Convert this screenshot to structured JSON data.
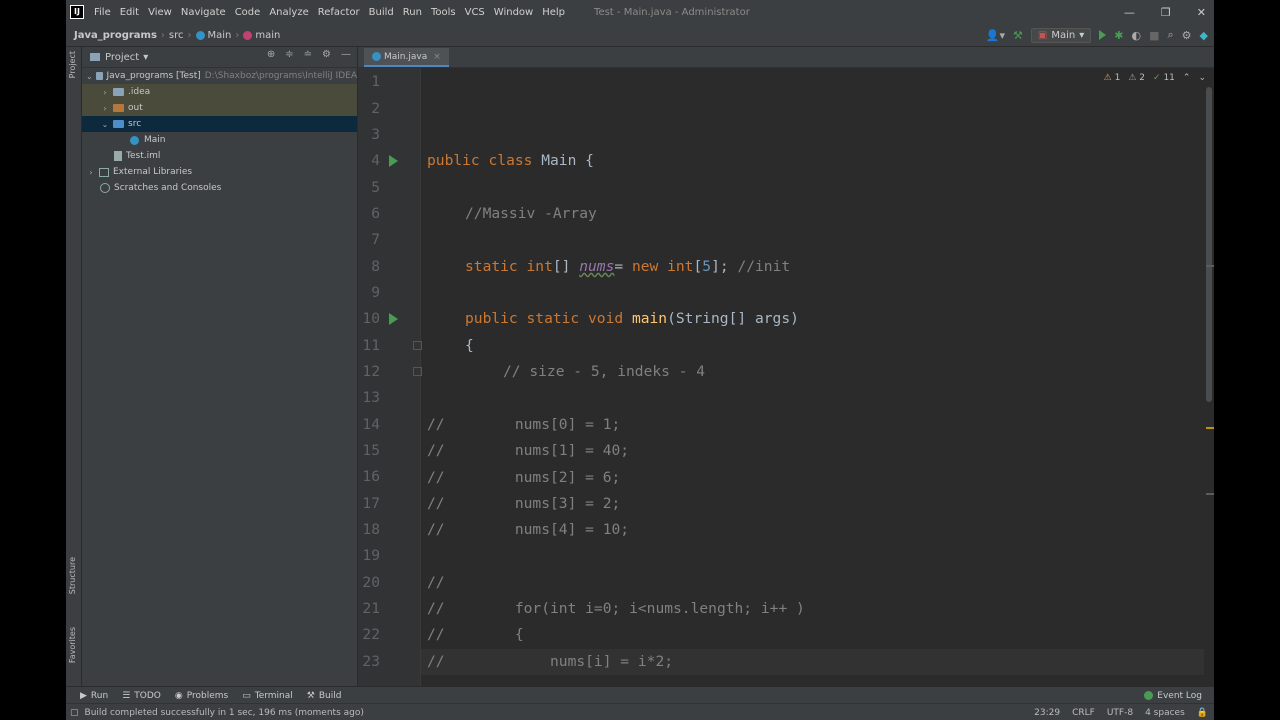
{
  "app": {
    "logo": "IJ",
    "window_title": "Test - Main.java - Administrator",
    "window_buttons": [
      "—",
      "❐",
      "✕"
    ]
  },
  "menu": [
    "File",
    "Edit",
    "View",
    "Navigate",
    "Code",
    "Analyze",
    "Refactor",
    "Build",
    "Run",
    "Tools",
    "VCS",
    "Window",
    "Help"
  ],
  "navbar": {
    "project": "Java_programs",
    "folder": "src",
    "class": "Main",
    "method": "main"
  },
  "toolbar": {
    "run_config": "Main"
  },
  "left_stripe": {
    "project": "Project",
    "structure": "Structure",
    "favorites": "Favorites"
  },
  "project_panel": {
    "title": "Project",
    "tree": [
      {
        "label": "Java_programs [Test]",
        "path": "D:\\Shaxboz\\programs\\IntelliJ IDEA",
        "level": 0,
        "expanded": true,
        "kind": "module"
      },
      {
        "label": ".idea",
        "level": 1,
        "expanded": false,
        "kind": "folder"
      },
      {
        "label": "out",
        "level": 1,
        "expanded": false,
        "kind": "folder-orange"
      },
      {
        "label": "src",
        "level": 1,
        "expanded": true,
        "kind": "folder-blue"
      },
      {
        "label": "Main",
        "level": 2,
        "kind": "class"
      },
      {
        "label": "Test.iml",
        "level": 1,
        "kind": "file"
      },
      {
        "label": "External Libraries",
        "level": 0,
        "expanded": false,
        "kind": "lib"
      },
      {
        "label": "Scratches and Consoles",
        "level": 0,
        "kind": "scratch"
      }
    ]
  },
  "editor": {
    "tab": "Main.java",
    "warnings": {
      "warn": "1",
      "weak": "2",
      "typo": "11"
    },
    "line_numbers": [
      "1",
      "2",
      "3",
      "4",
      "5",
      "6",
      "7",
      "8",
      "9",
      "10",
      "11",
      "12",
      "13",
      "14",
      "15",
      "16",
      "17",
      "18",
      "19",
      "20",
      "21",
      "22",
      "23"
    ],
    "lines": {
      "l4_kw": "public class ",
      "l4_name": "Main {",
      "l6": "//Massiv -Array",
      "l8_kw1": "static int",
      "l8_a": "[] ",
      "l8_fld": "nums",
      "l8_b": "= ",
      "l8_kw2": "new int",
      "l8_c": "[",
      "l8_num": "5",
      "l8_d": "];",
      "l8_cm": " //init",
      "l10_kw": "public static void ",
      "l10_fn": "main",
      "l10_rest": "(String[] args)",
      "l11": "{",
      "l12": "// size - 5, indeks - 4",
      "l14": "//        nums[0] = 1;",
      "l15": "//        nums[1] = 40;",
      "l16": "//        nums[2] = 6;",
      "l17": "//        nums[3] = 2;",
      "l18": "//        nums[4] = 10;",
      "l20": "//",
      "l21": "//        for(int i=0; i<nums.length; i++ )",
      "l22": "//        {",
      "l23": "//            nums[i] = i*2;"
    }
  },
  "bottom_tools": [
    "Run",
    "TODO",
    "Problems",
    "Terminal",
    "Build"
  ],
  "event_log": "Event Log",
  "status": {
    "message": "Build completed successfully in 1 sec, 196 ms (moments ago)",
    "position": "23:29",
    "line_sep": "CRLF",
    "encoding": "UTF-8",
    "indent": "4 spaces"
  }
}
